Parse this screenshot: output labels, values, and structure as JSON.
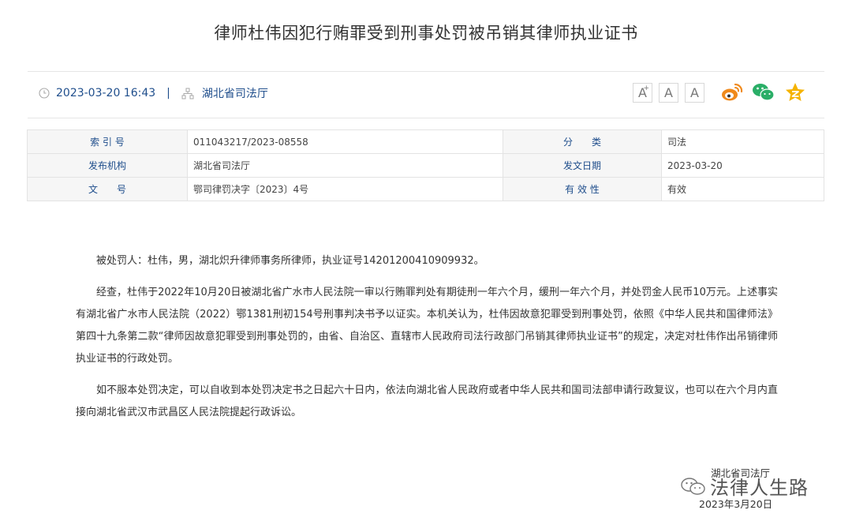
{
  "title": "律师杜伟因犯行贿罪受到刑事处罚被吊销其律师执业证书",
  "meta": {
    "datetime": "2023-03-20 16:43",
    "separator": "|",
    "source": "湖北省司法厅",
    "font_buttons": [
      "A",
      "A",
      "A"
    ],
    "font_plus": "+"
  },
  "info_table": {
    "rows": [
      {
        "label1": "索 引 号",
        "value1": "011043217/2023-08558",
        "label2": "分　　类",
        "value2": "司法"
      },
      {
        "label1": "发布机构",
        "value1": "湖北省司法厅",
        "label2": "发文日期",
        "value2": "2023-03-20"
      },
      {
        "label1": "文　　号",
        "value1": "鄂司律罚决字〔2023〕4号",
        "label2": "有 效 性",
        "value2": "有效"
      }
    ]
  },
  "body": {
    "paragraphs": [
      "被处罚人：杜伟，男，湖北炽升律师事务所律师，执业证号14201200410909932。",
      "经查，杜伟于2022年10月20日被湖北省广水市人民法院一审以行贿罪判处有期徒刑一年六个月，缓刑一年六个月，并处罚金人民币10万元。上述事实有湖北省广水市人民法院（2022）鄂1381刑初154号刑事判决书予以证实。本机关认为，杜伟因故意犯罪受到刑事处罚，依照《中华人民共和国律师法》第四十九条第二款“律师因故意犯罪受到刑事处罚的，由省、自治区、直辖市人民政府司法行政部门吊销其律师执业证书”的规定，决定对杜伟作出吊销律师执业证书的行政处罚。",
      "如不服本处罚决定，可以自收到本处罚决定书之日起六十日内，依法向湖北省人民政府或者中华人民共和国司法部申请行政复议，也可以在六个月内直接向湖北省武汉市武昌区人民法院提起行政诉讼。"
    ]
  },
  "signature": {
    "org": "湖北省司法厅",
    "date": "2023年3月20日"
  },
  "watermark": "法律人生路",
  "icons": [
    "clock-icon",
    "org-chart-icon",
    "weibo-icon",
    "wechat-icon",
    "qzone-icon"
  ],
  "colors": {
    "link_blue": "#1f4e8c",
    "weibo": "#f08a1c",
    "wechat": "#2aae67",
    "qzone": "#f5b301"
  }
}
